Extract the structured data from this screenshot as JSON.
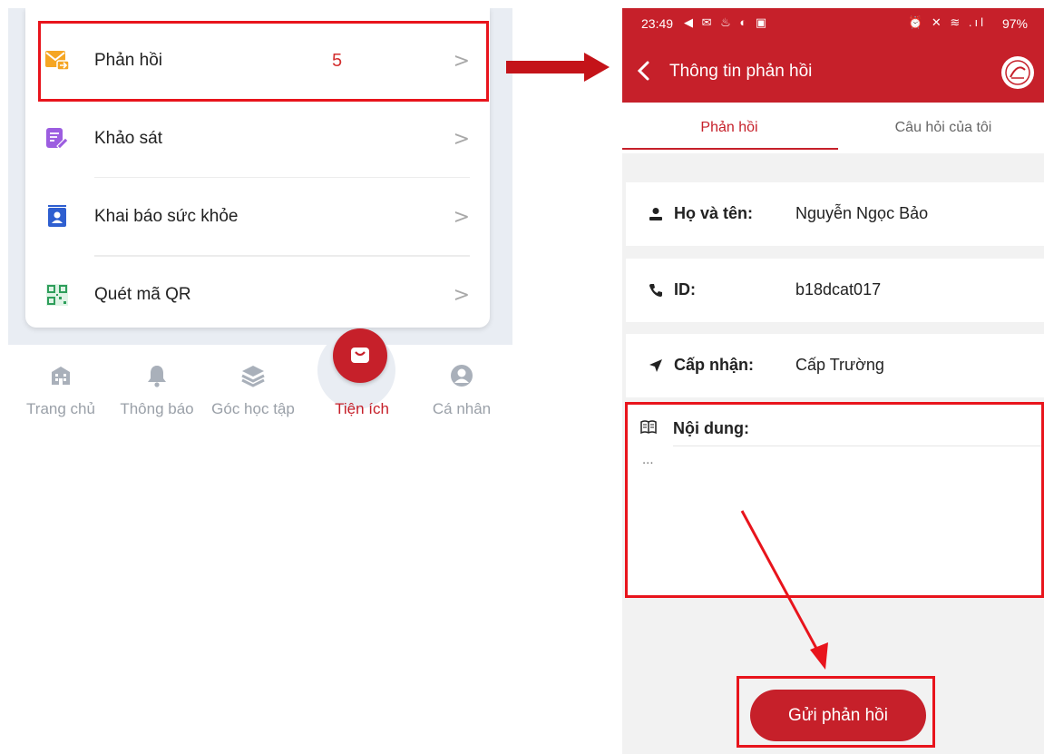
{
  "menu": {
    "items": [
      {
        "label": "Phản hồi",
        "icon": "feedback-envelope-icon"
      },
      {
        "label": "Khảo sát",
        "icon": "survey-pencil-icon"
      },
      {
        "label": "Khai báo sức khỏe",
        "icon": "health-declaration-icon"
      },
      {
        "label": "Quét mã QR",
        "icon": "qr-code-icon"
      }
    ],
    "chevron": ">",
    "step_number": "5"
  },
  "bottom_nav": {
    "items": [
      {
        "label": "Trang chủ",
        "icon": "home-building-icon"
      },
      {
        "label": "Thông báo",
        "icon": "bell-icon"
      },
      {
        "label": "Góc học tập",
        "icon": "layers-icon"
      },
      {
        "label": "Tiện ích",
        "icon": "bag-icon",
        "active": true
      },
      {
        "label": "Cá nhân",
        "icon": "user-icon"
      }
    ]
  },
  "phone": {
    "status": {
      "time": "23:49",
      "left_icons": "◀ ✉ ♨ ◐ ▣",
      "right_icons": "⏰ ✕ ≋ .ıl",
      "battery": "97%"
    },
    "app_title": "Thông tin phản hồi",
    "tabs": [
      "Phản hồi",
      "Câu hỏi của tôi"
    ],
    "fields": [
      {
        "label": "Họ và tên:",
        "value": "Nguyễn Ngọc Bảo",
        "icon": "person-icon"
      },
      {
        "label": "ID:",
        "value": "b18dcat017",
        "icon": "phone-icon"
      },
      {
        "label": "Cấp nhận:",
        "value": "Cấp Trường",
        "icon": "send-arrow-icon"
      }
    ],
    "content": {
      "label": "Nội dung:",
      "placeholder": "...",
      "icon": "book-icon"
    },
    "submit_label": "Gửi phản hồi"
  },
  "colors": {
    "brand": "#c6202a",
    "annotation": "#e8141c",
    "nav_inactive": "#9aa0a8"
  }
}
